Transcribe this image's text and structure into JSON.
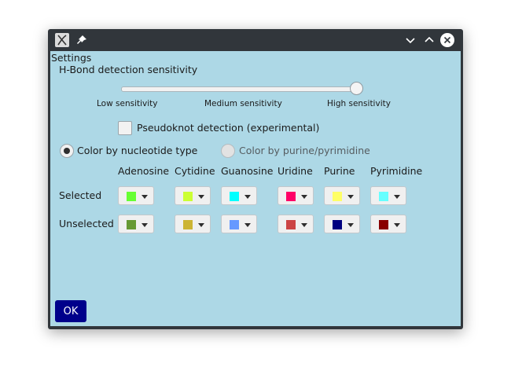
{
  "window": {
    "app_icon": "x-app-icon",
    "pin_icon": "pin-icon"
  },
  "settings_label": "Settings",
  "hbond": {
    "label": "H-Bond detection sensitivity",
    "low": "Low sensitivity",
    "medium": "Medium sensitivity",
    "high": "High sensitivity",
    "value": "high"
  },
  "pseudoknot": {
    "label": "Pseudoknot detection (experimental)",
    "checked": false
  },
  "color_mode": {
    "option1": "Color by nucleotide type",
    "option2": "Color by purine/pyrimidine",
    "selected": "option1"
  },
  "columns": [
    "Adenosine",
    "Cytidine",
    "Guanosine",
    "Uridine",
    "Purine",
    "Pyrimidine"
  ],
  "rows": {
    "selected": "Selected",
    "unselected": "Unselected"
  },
  "colors": {
    "selected": [
      "#66ff33",
      "#ccff33",
      "#00ffff",
      "#ff0066",
      "#ffff66",
      "#66ffff"
    ],
    "unselected": [
      "#669933",
      "#ccb433",
      "#6699ff",
      "#cc4444",
      "#000080",
      "#880000"
    ]
  },
  "ok_label": "OK"
}
